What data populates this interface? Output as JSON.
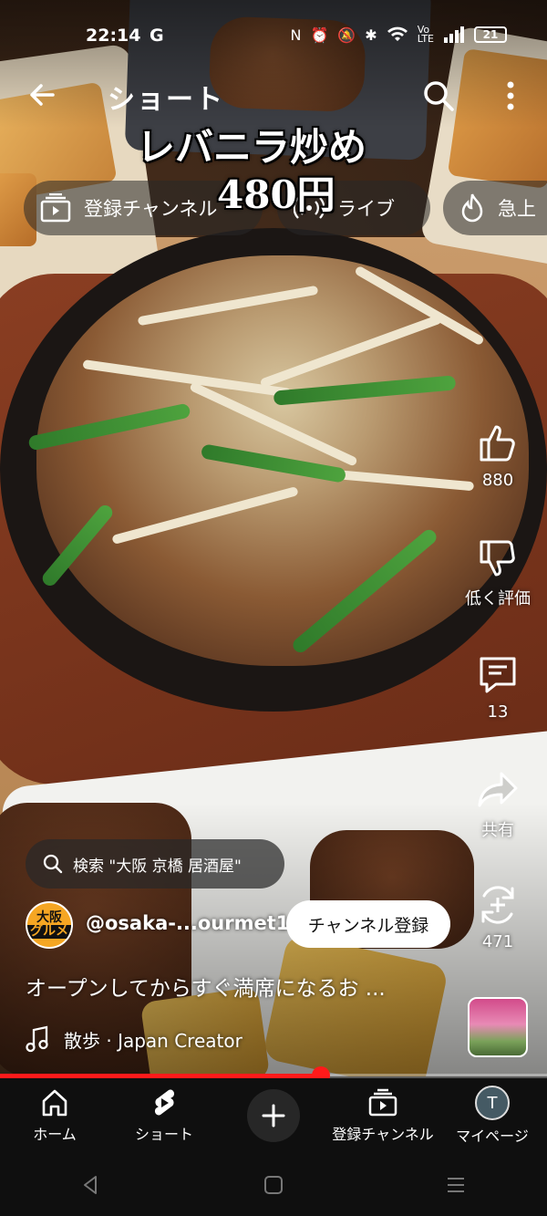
{
  "status": {
    "time": "22:14",
    "carrier_icon": "G",
    "battery": "21"
  },
  "header": {
    "title": "ショート"
  },
  "video_overlay": {
    "dish": "レバニラ炒め",
    "price": "480円"
  },
  "chips": [
    {
      "label": "登録チャンネル",
      "icon": "subscriptions-icon"
    },
    {
      "label": "ライブ",
      "icon": "live-icon"
    },
    {
      "label": "急上",
      "icon": "trending-icon"
    }
  ],
  "actions": {
    "like_count": "880",
    "dislike_label": "低く評価",
    "comment_count": "13",
    "share_label": "共有",
    "remix_count": "471"
  },
  "search_suggestion": "検索 \"大阪 京橋 居酒屋\"",
  "channel": {
    "avatar_top": "大阪",
    "avatar_bottom": "グルメ",
    "handle": "@osaka-...ourmet1",
    "subscribe_label": "チャンネル登録"
  },
  "caption": "オープンしてからすぐ満席になるお ...",
  "music": "散歩 · Japan Creator",
  "progress": {
    "fraction": 0.587
  },
  "bottom_nav": [
    {
      "label": "ホーム",
      "icon": "home-icon"
    },
    {
      "label": "ショート",
      "icon": "shorts-icon"
    },
    {
      "label": "",
      "icon": "create-icon"
    },
    {
      "label": "登録チャンネル",
      "icon": "subscriptions-icon"
    },
    {
      "label": "マイページ",
      "icon": "avatar",
      "initial": "T"
    }
  ]
}
